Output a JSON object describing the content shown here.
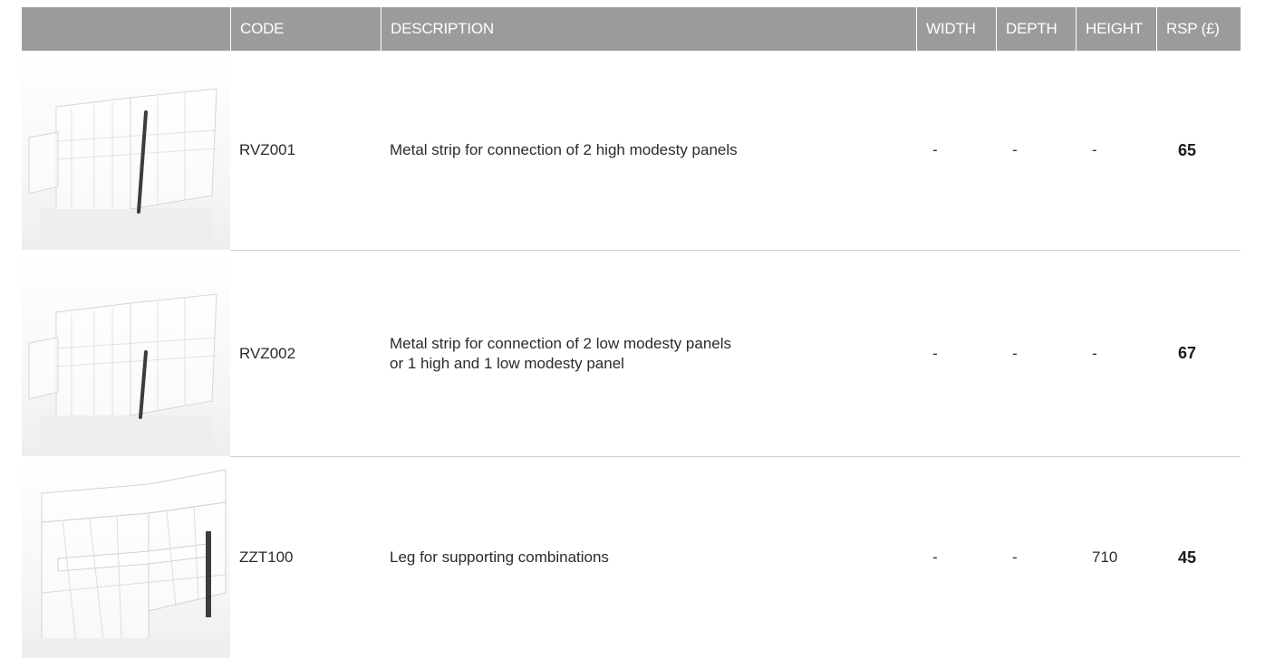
{
  "table": {
    "headers": {
      "image": "",
      "code": "CODE",
      "description": "DESCRIPTION",
      "width": "WIDTH",
      "depth": "DEPTH",
      "height": "HEIGHT",
      "rsp": "RSP (£)"
    },
    "rows": [
      {
        "image_icon": "metal-strip-high-panels-image",
        "code": "RVZ001",
        "description_line1": "Metal strip for connection of 2 high modesty panels",
        "description_line2": "",
        "width": "-",
        "depth": "-",
        "height": "-",
        "rsp": "65"
      },
      {
        "image_icon": "metal-strip-low-panels-image",
        "code": "RVZ002",
        "description_line1": "Metal strip for connection of 2 low modesty panels",
        "description_line2": "or 1 high and 1 low modesty panel",
        "width": "-",
        "depth": "-",
        "height": "-",
        "rsp": "67"
      },
      {
        "image_icon": "support-leg-image",
        "code": "ZZT100",
        "description_line1": "Leg for supporting combinations",
        "description_line2": "",
        "width": "-",
        "depth": "-",
        "height": "710",
        "rsp": "45"
      }
    ]
  },
  "colors": {
    "header_bg": "#9b9b9b",
    "header_text": "#ffffff",
    "divider": "#cfcfcf",
    "strip": "#3a3d40"
  }
}
